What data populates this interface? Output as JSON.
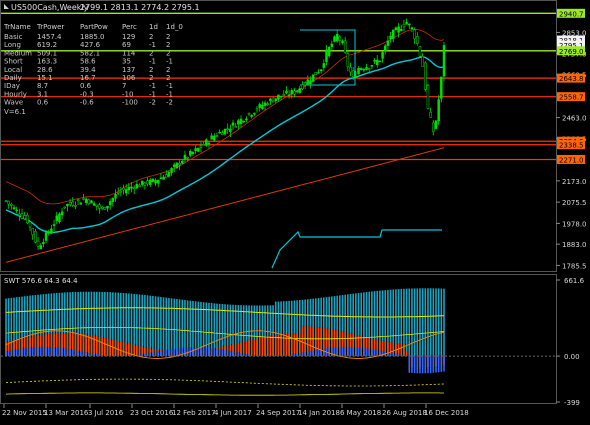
{
  "header": {
    "title": "US500Cash,Weekly",
    "ohlc": "2799.1 2813.1 2774.2 2795.1"
  },
  "table": {
    "columns": [
      "TrName",
      "TrPower",
      "PartPow",
      "Perc",
      "1d",
      "1d_0"
    ],
    "rows": [
      [
        "Basic",
        "1457.4",
        "1885.0",
        "129",
        "2",
        "2"
      ],
      [
        "Long",
        "619.2",
        "427.6",
        "69",
        "-1",
        "2"
      ],
      [
        "Medium",
        "509.1",
        "582.1",
        "114",
        "2",
        "2"
      ],
      [
        "Short",
        "163.3",
        "58.6",
        "35",
        "-1",
        "-1"
      ],
      [
        "Local",
        "28.6",
        "39.4",
        "137",
        "2",
        "2"
      ],
      [
        "Daily",
        "15.1",
        "16.7",
        "106",
        "2",
        "2"
      ],
      [
        "IDay",
        "8.7",
        "0.6",
        "7",
        "-1",
        "-1"
      ],
      [
        "Hourly",
        "3.1",
        "-0.3",
        "-10",
        "-1",
        "-1"
      ],
      [
        "Wave",
        "0.6",
        "-0.6",
        "-100",
        "-2",
        "-2"
      ]
    ],
    "footer": "V=6.1"
  },
  "price_axis": {
    "ticks": [
      "2853.0",
      "2757.0",
      "2660.5",
      "2463.0",
      "2366.5",
      "2173.0",
      "2075.5",
      "1978.0",
      "1883.0",
      "1785.5"
    ],
    "labels": [
      {
        "text": "2940.7",
        "color": "#9be829"
      },
      {
        "text": "2818.1",
        "color": "#f2f2f2"
      },
      {
        "text": "2795.1",
        "color": "#f2f2f2"
      },
      {
        "text": "2769.0",
        "color": "#9be829"
      },
      {
        "text": "2643.8",
        "color": "#ff6600"
      },
      {
        "text": "2558.7",
        "color": "#ff6600"
      },
      {
        "text": "2354.6",
        "color": "#ff6600"
      },
      {
        "text": "2338.5",
        "color": "#ff6600"
      },
      {
        "text": "2271.0",
        "color": "#ff6600"
      }
    ]
  },
  "sub_window": {
    "title": "SWT 576.6 64.3 64.4",
    "ticks": [
      "661.6",
      "0.00",
      "-399"
    ]
  },
  "time_axis": {
    "labels": [
      "22 Nov 2015",
      "13 Mar 2016",
      "3 Jul 2016",
      "23 Oct 2016",
      "12 Feb 2017",
      "4 Jun 2017",
      "24 Sep 2017",
      "14 Jan 2018",
      "6 May 2018",
      "26 Aug 2018",
      "16 Dec 2018"
    ]
  },
  "colors": {
    "background": "#000000",
    "candles": "#00e000",
    "ma": "#00c8d8",
    "levels": "#ff3300",
    "green_level": "#9be829",
    "swt_cyan": "#1aa3c0",
    "swt_orange": "#ff4400",
    "swt_yellow": "#e8e800",
    "swt_blue": "#3366ff"
  }
}
